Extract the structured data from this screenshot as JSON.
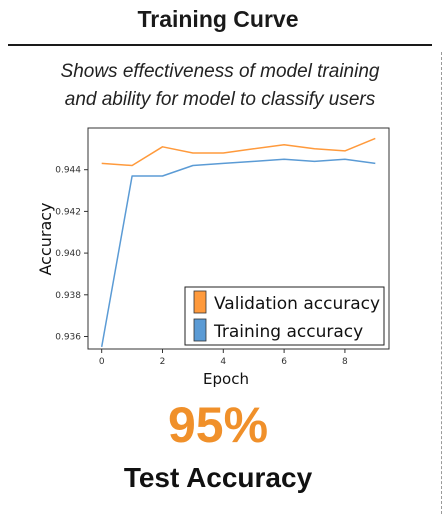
{
  "header": {
    "title": "Training Curve",
    "subtitle_line1": "Shows effectiveness of model training",
    "subtitle_line2": "and ability for model to classify users"
  },
  "chart_data": {
    "type": "line",
    "xlabel": "Epoch",
    "ylabel": "Accuracy",
    "x": [
      0,
      1,
      2,
      3,
      4,
      5,
      6,
      7,
      8,
      9
    ],
    "xlim": [
      -0.45,
      9.45
    ],
    "ylim": [
      0.9354,
      0.946
    ],
    "xticks": [
      0,
      2,
      4,
      6,
      8
    ],
    "yticks": [
      0.936,
      0.938,
      0.94,
      0.942,
      0.944
    ],
    "xtick_labels": [
      "0",
      "2",
      "4",
      "6",
      "8"
    ],
    "ytick_labels": [
      "0.936",
      "0.938",
      "0.940",
      "0.942",
      "0.944"
    ],
    "grid": false,
    "legend_position": "lower-right",
    "series": [
      {
        "name": "Validation accuracy",
        "color": "#ff9a3c",
        "values": [
          0.9443,
          0.9442,
          0.9451,
          0.9448,
          0.9448,
          0.945,
          0.9452,
          0.945,
          0.9449,
          0.9455
        ]
      },
      {
        "name": "Training accuracy",
        "color": "#5b9bd5",
        "values": [
          0.9355,
          0.9437,
          0.9437,
          0.9442,
          0.9443,
          0.9444,
          0.9445,
          0.9444,
          0.9445,
          0.9443
        ]
      }
    ]
  },
  "stat": {
    "value": "95%",
    "label": "Test Accuracy",
    "value_color": "#f0902a"
  }
}
